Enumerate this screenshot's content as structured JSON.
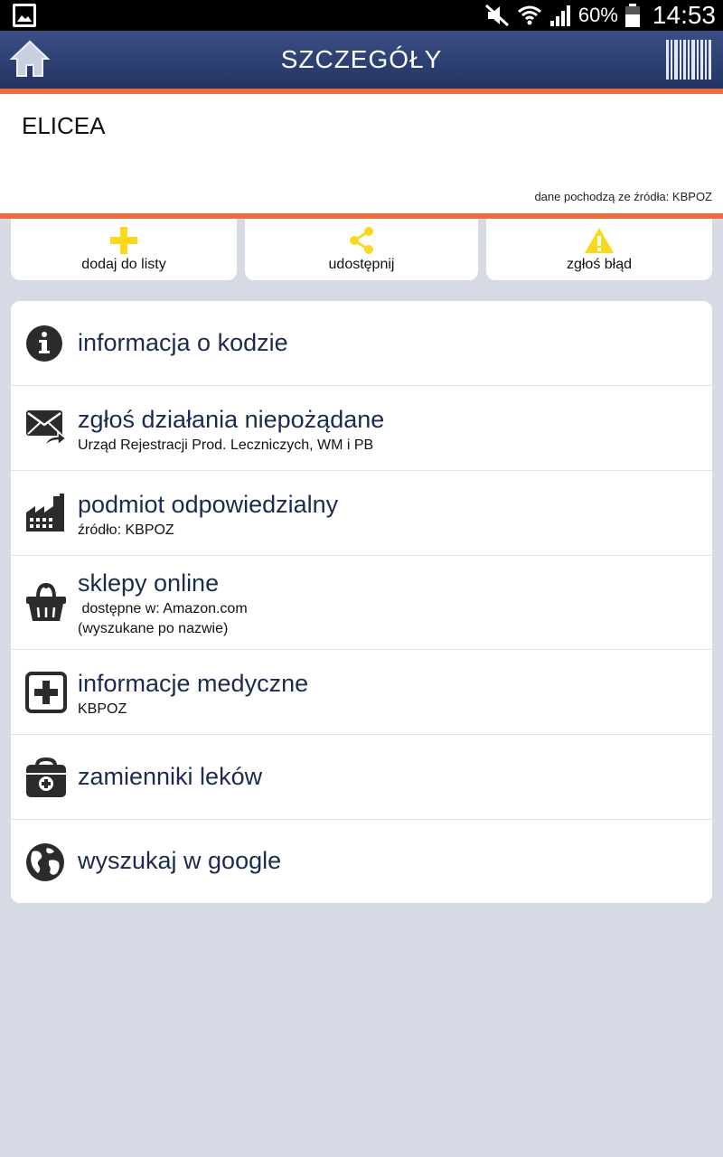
{
  "status_bar": {
    "battery": "60%",
    "time": "14:53"
  },
  "app_bar": {
    "title": "SZCZEGÓŁY"
  },
  "product": {
    "name": "ELICEA",
    "source": "dane pochodzą ze źródła:  KBPOZ"
  },
  "actions": [
    {
      "label": "dodaj do listy",
      "icon": "plus-icon"
    },
    {
      "label": "udostępnij",
      "icon": "share-icon"
    },
    {
      "label": "zgłoś błąd",
      "icon": "warning-icon"
    }
  ],
  "menu": [
    {
      "title": "informacja o kodzie",
      "icon": "info-icon"
    },
    {
      "title": "zgłoś działania niepożądane",
      "sub": "Urząd Rejestracji Prod. Leczniczych, WM i PB",
      "icon": "mail-forward-icon"
    },
    {
      "title": "podmiot odpowiedzialny",
      "sub": "źródło: KBPOZ",
      "icon": "factory-icon"
    },
    {
      "title": "sklepy online",
      "sub": " dostępne w: Amazon.com",
      "sub2": "(wyszukane po nazwie)",
      "icon": "basket-icon"
    },
    {
      "title": "informacje medyczne",
      "sub": "KBPOZ",
      "icon": "medical-plus-icon"
    },
    {
      "title": "zamienniki leków",
      "icon": "medical-bag-icon"
    },
    {
      "title": "wyszukaj w google",
      "icon": "globe-icon"
    }
  ],
  "colors": {
    "accent": "#f06b3f",
    "app_bar": "#2a3b6c",
    "icon_yellow": "#f9d91a",
    "title_text": "#1b2b4f",
    "background": "#d5dae5"
  }
}
